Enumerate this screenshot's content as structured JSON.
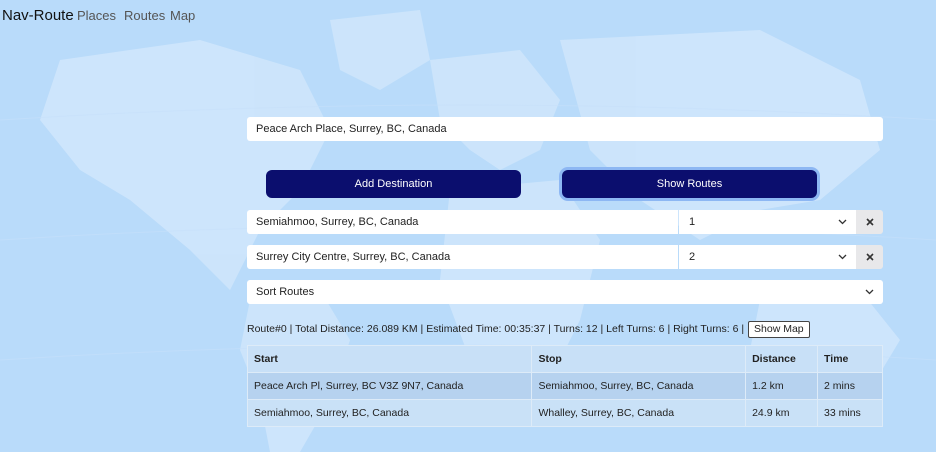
{
  "nav": {
    "brand": "Nav-Route",
    "links": [
      "Places",
      "Routes",
      "Map"
    ]
  },
  "origin": {
    "value": "Peace Arch Place, Surrey, BC, Canada"
  },
  "buttons": {
    "add_destination": "Add Destination",
    "show_routes": "Show Routes"
  },
  "destinations": [
    {
      "value": "Semiahmoo, Surrey, BC, Canada",
      "order": "1"
    },
    {
      "value": "Surrey City Centre, Surrey, BC, Canada",
      "order": "2"
    }
  ],
  "icons": {
    "select_chevron": "chevron-down-icon",
    "remove": "close-icon"
  },
  "sort": {
    "label": "Sort Routes"
  },
  "route_summary": {
    "text": "Route#0 | Total Distance: 26.089 KM | Estimated Time: 00:35:37 | Turns: 12 | Left Turns: 6 | Right Turns: 6 |",
    "show_map_label": "Show Map"
  },
  "table": {
    "headers": [
      "Start",
      "Stop",
      "Distance",
      "Time"
    ],
    "rows": [
      [
        "Peace Arch Pl, Surrey, BC V3Z 9N7, Canada",
        "Semiahmoo, Surrey, BC, Canada",
        "1.2 km",
        "2 mins"
      ],
      [
        "Semiahmoo, Surrey, BC, Canada",
        "Whalley, Surrey, BC, Canada",
        "24.9 km",
        "33 mins"
      ]
    ]
  },
  "colors": {
    "button": "#0b0e6e",
    "background": "#b9dbfa"
  }
}
